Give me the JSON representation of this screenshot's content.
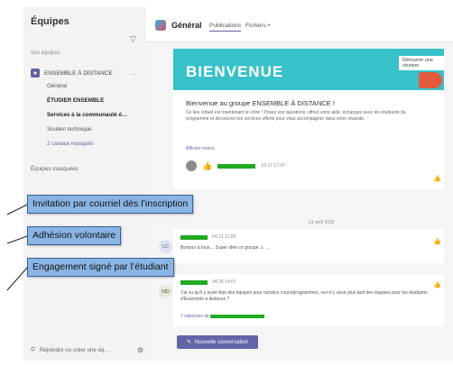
{
  "sidebar": {
    "title": "Équipes",
    "section_label": "Vos équipes",
    "team_name": "ENSEMBLE À DISTANCE",
    "team_more": "…",
    "channels": [
      {
        "label": "Général"
      },
      {
        "label": "ÉTUDIER ENSEMBLE"
      },
      {
        "label": "Services à la communauté é…"
      },
      {
        "label": "Soutien technique"
      },
      {
        "label": "2 canaux masqués"
      }
    ],
    "hidden_teams_label": "Équipes masquées",
    "join_label": "Rejoindre ou créer une éq…"
  },
  "header": {
    "channel_name": "Général",
    "tabs": [
      "Publications",
      "Fichiers",
      "+"
    ]
  },
  "banner": {
    "title": "BIENVENUE",
    "action": "Démarrer une réunion"
  },
  "post": {
    "title": "Bienvenue au groupe ENSEMBLE À DISTANCE !",
    "body": "Ce lieu virtuel est maintenant le vôtre ! Posez vos questions, offrez votre aide, échangez avec les étudiants du programme et découvrez les services offerts pour vous accompagner dans votre réussite.",
    "more": "Afficher moins",
    "reply_time": "10-17 17:47"
  },
  "date_separator": "21 avril 2022",
  "messages": [
    {
      "initials": "LC",
      "time": "04-21 11:09",
      "text": "Bonjour à tous… Super idée ce groupe ⚠ …"
    },
    {
      "initials": "MD",
      "time": "04-26 14:07",
      "text": "J'ai vu qu'il y avait déjà des équipes pour certains cours/programmes, va-t-il y avoir plus tard des équipes pour les étudiants d'Ensemble à distance ?",
      "link": "7 réponses de"
    }
  ],
  "new_conversation": "Nouvelle conversation",
  "callouts": [
    "Invitation par courriel dès l’inscription",
    "Adhésion volontaire",
    "Engagement signé par l’étudiant"
  ],
  "colors": {
    "accent": "#6264a7",
    "banner": "#39c1c9",
    "callout_fill": "#8ab4e3",
    "callout_border": "#3a5f95",
    "redaction": "#22aa22"
  }
}
